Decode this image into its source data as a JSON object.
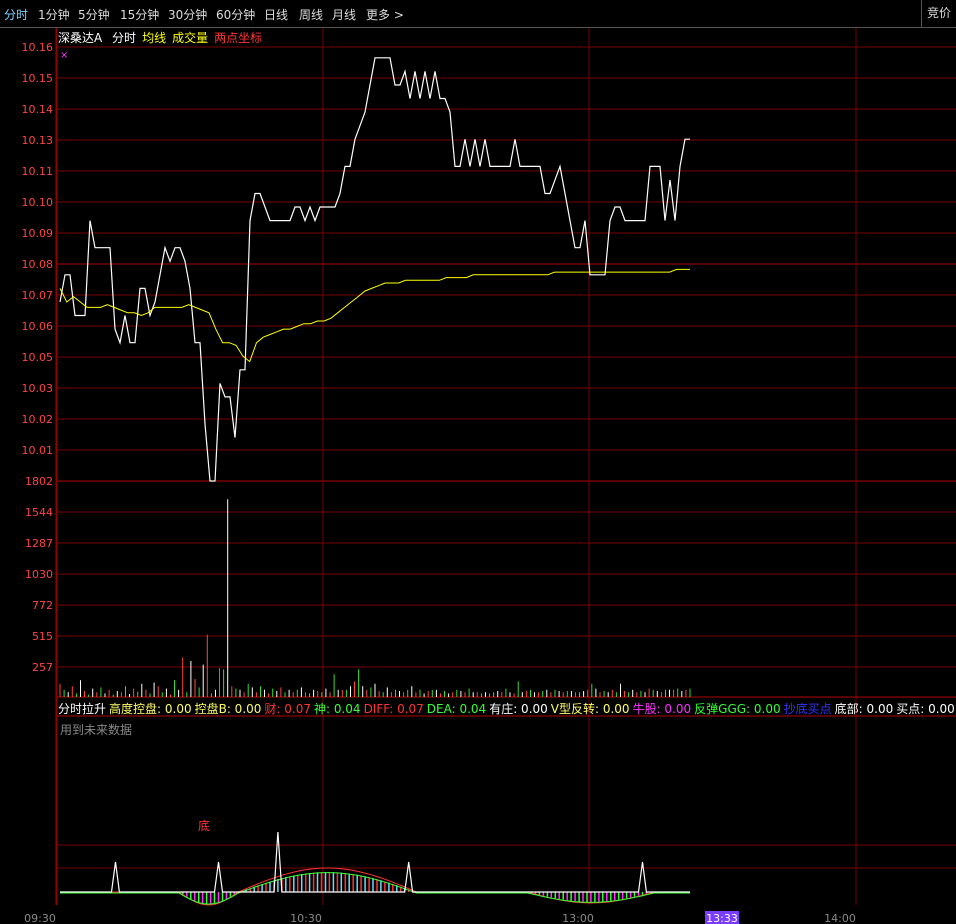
{
  "toolbar": {
    "tabs": [
      {
        "label": "分时",
        "active": true
      },
      {
        "label": "1分钟"
      },
      {
        "label": "5分钟"
      },
      {
        "label": "15分钟"
      },
      {
        "label": "30分钟"
      },
      {
        "label": "60分钟"
      },
      {
        "label": "日线"
      },
      {
        "label": "周线"
      },
      {
        "label": "月线"
      },
      {
        "label": "更多 >"
      }
    ],
    "right_label": "竞价"
  },
  "legend": {
    "stock_name": "深桑达A",
    "items": [
      {
        "label": "分时",
        "color": "#ffffff"
      },
      {
        "label": "均线",
        "color": "#ffff00"
      },
      {
        "label": "成交量",
        "color": "#ffff00"
      },
      {
        "label": "两点坐标",
        "color": "#ff3333"
      }
    ],
    "marker": "×"
  },
  "indicator": {
    "items": [
      {
        "label": "分时拉升",
        "color": "#ffffff"
      },
      {
        "label": "高度控盘: 0.00",
        "color": "#ffff66"
      },
      {
        "label": "控盘B: 0.00",
        "color": "#ffff66"
      },
      {
        "label": "财: 0.07",
        "color": "#ff3333"
      },
      {
        "label": "神: 0.04",
        "color": "#33ff33"
      },
      {
        "label": "DIFF: 0.07",
        "color": "#ff3333"
      },
      {
        "label": "DEA: 0.04",
        "color": "#33ff33"
      },
      {
        "label": "有庄: 0.00",
        "color": "#ffffff"
      },
      {
        "label": "V型反转: 0.00",
        "color": "#ffff66"
      },
      {
        "label": "牛股: 0.00",
        "color": "#ff33ff"
      },
      {
        "label": "反弹GGG: 0.00",
        "color": "#33ff33"
      },
      {
        "label": "抄底买点",
        "color": "#3333ff"
      },
      {
        "label": "底部: 0.00",
        "color": "#ffffff"
      },
      {
        "label": "买点: 0.00",
        "color": "#ffffff"
      }
    ],
    "note": "用到未来数据",
    "bottom_marker": "底"
  },
  "time_axis": [
    "09:30",
    "10:30",
    "13:00",
    "14:00"
  ],
  "cursor_time": "13:33",
  "chart_data": [
    {
      "type": "line",
      "title": "分时",
      "y_ticks": [
        "10.16",
        "10.15",
        "10.14",
        "10.13",
        "10.11",
        "10.10",
        "10.09",
        "10.08",
        "10.07",
        "10.06",
        "10.05",
        "10.03",
        "10.02",
        "10.01"
      ],
      "ylim": [
        10.004,
        10.164
      ],
      "reference_price": 10.08,
      "series": [
        {
          "name": "分时",
          "color": "#ffffff",
          "values": [
            10.07,
            10.08,
            10.08,
            10.065,
            10.065,
            10.065,
            10.1,
            10.09,
            10.09,
            10.09,
            10.09,
            10.06,
            10.055,
            10.065,
            10.055,
            10.055,
            10.075,
            10.075,
            10.065,
            10.07,
            10.08,
            10.09,
            10.085,
            10.09,
            10.09,
            10.085,
            10.075,
            10.055,
            10.055,
            10.025,
            10.004,
            10.004,
            10.04,
            10.035,
            10.035,
            10.02,
            10.045,
            10.045,
            10.1,
            10.11,
            10.11,
            10.105,
            10.1,
            10.1,
            10.1,
            10.1,
            10.1,
            10.105,
            10.105,
            10.1,
            10.105,
            10.1,
            10.105,
            10.105,
            10.105,
            10.105,
            10.11,
            10.12,
            10.12,
            10.13,
            10.135,
            10.14,
            10.15,
            10.16,
            10.16,
            10.16,
            10.16,
            10.15,
            10.15,
            10.155,
            10.145,
            10.155,
            10.145,
            10.155,
            10.145,
            10.155,
            10.145,
            10.145,
            10.14,
            10.12,
            10.12,
            10.13,
            10.12,
            10.13,
            10.12,
            10.13,
            10.12,
            10.12,
            10.12,
            10.12,
            10.12,
            10.13,
            10.12,
            10.12,
            10.12,
            10.12,
            10.12,
            10.11,
            10.11,
            10.115,
            10.12,
            10.11,
            10.1,
            10.09,
            10.09,
            10.1,
            10.08,
            10.08,
            10.08,
            10.08,
            10.1,
            10.105,
            10.105,
            10.1,
            10.1,
            10.1,
            10.1,
            10.1,
            10.12,
            10.12,
            10.12,
            10.1,
            10.115,
            10.1,
            10.12,
            10.13,
            10.13
          ]
        },
        {
          "name": "均线",
          "color": "#ffff00",
          "values": [
            10.075,
            10.07,
            10.072,
            10.07,
            10.068,
            10.068,
            10.068,
            10.069,
            10.068,
            10.067,
            10.066,
            10.066,
            10.065,
            10.066,
            10.068,
            10.068,
            10.068,
            10.068,
            10.068,
            10.069,
            10.068,
            10.067,
            10.066,
            10.06,
            10.055,
            10.055,
            10.054,
            10.05,
            10.048,
            10.055,
            10.057,
            10.058,
            10.059,
            10.06,
            10.06,
            10.061,
            10.062,
            10.062,
            10.063,
            10.063,
            10.064,
            10.066,
            10.068,
            10.07,
            10.072,
            10.074,
            10.075,
            10.076,
            10.077,
            10.077,
            10.077,
            10.078,
            10.078,
            10.078,
            10.078,
            10.078,
            10.078,
            10.079,
            10.079,
            10.079,
            10.079,
            10.08,
            10.08,
            10.08,
            10.08,
            10.08,
            10.08,
            10.08,
            10.08,
            10.08,
            10.08,
            10.08,
            10.08,
            10.081,
            10.081,
            10.081,
            10.081,
            10.081,
            10.081,
            10.081,
            10.081,
            10.081,
            10.081,
            10.081,
            10.081,
            10.081,
            10.081,
            10.081,
            10.081,
            10.081,
            10.081,
            10.082,
            10.082,
            10.082
          ]
        }
      ]
    },
    {
      "type": "bar",
      "title": "成交量",
      "y_ticks": [
        "1802",
        "1544",
        "1287",
        "1030",
        "772",
        "515",
        "257"
      ],
      "ylim": [
        0,
        1802
      ],
      "values": [
        110,
        60,
        40,
        90,
        30,
        140,
        50,
        20,
        70,
        40,
        80,
        30,
        60,
        20,
        50,
        40,
        90,
        25,
        70,
        45,
        110,
        60,
        30,
        120,
        90,
        40,
        70,
        20,
        140,
        60,
        330,
        40,
        300,
        150,
        80,
        270,
        520,
        30,
        60,
        240,
        230,
        1650,
        90,
        70,
        60,
        40,
        110,
        80,
        40,
        90,
        60,
        30,
        70,
        50,
        80,
        40,
        60,
        40,
        60,
        80,
        40,
        30,
        60,
        50,
        40,
        70,
        40,
        190,
        60,
        60,
        60,
        90,
        130,
        230,
        90,
        60,
        80,
        110,
        50,
        40,
        80,
        40,
        60,
        50,
        40,
        60,
        90,
        40,
        60,
        30,
        50,
        60,
        60,
        30,
        50,
        30,
        40,
        60,
        50,
        40,
        70,
        40,
        40,
        30,
        40,
        30,
        40,
        50,
        40,
        70,
        40,
        30,
        130,
        40,
        50,
        60,
        40,
        40,
        50,
        60,
        40,
        60,
        50,
        40,
        50,
        50,
        40,
        40,
        50,
        60,
        110,
        70,
        40,
        50,
        40,
        60,
        40,
        110,
        50,
        40,
        60,
        40,
        50,
        40,
        70,
        60,
        50,
        40,
        60,
        60,
        60,
        70,
        50,
        60,
        70
      ]
    }
  ]
}
